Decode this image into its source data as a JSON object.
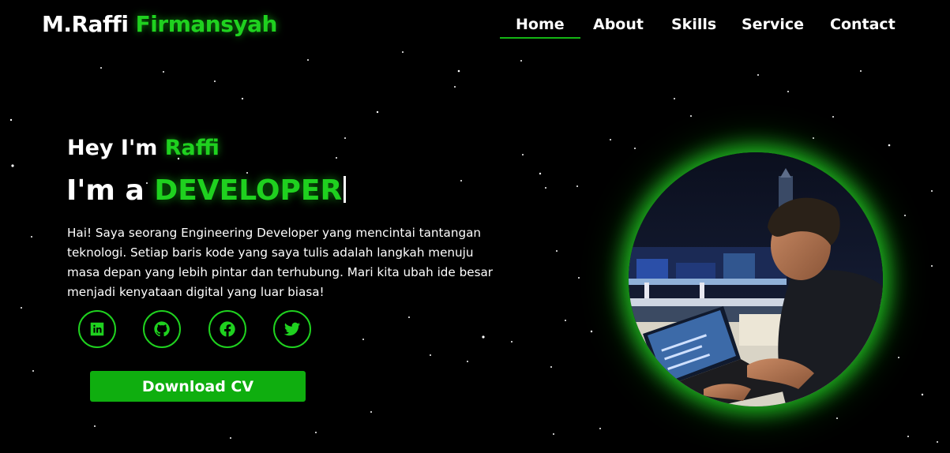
{
  "brand": {
    "first": "M.Raffi",
    "accent": "Firmansyah"
  },
  "nav": {
    "home": "Home",
    "about": "About",
    "skills": "Skills",
    "service": "Service",
    "contact": "Contact",
    "active": "Home"
  },
  "hero": {
    "greeting_prefix": "Hey I'm",
    "greeting_name": "Raffi",
    "role_prefix": "I'm a",
    "role_word": "DEVELOPER",
    "bio": "Hai! Saya seorang Engineering Developer yang mencintai tantangan teknologi. Setiap baris kode yang saya tulis adalah langkah menuju masa depan yang lebih pintar dan terhubung. Mari kita ubah ide besar menjadi kenyataan digital yang luar biasa!",
    "cv_button": "Download CV"
  },
  "socials": [
    {
      "icon": "linkedin-icon"
    },
    {
      "icon": "github-icon"
    },
    {
      "icon": "facebook-icon"
    },
    {
      "icon": "twitter-icon"
    }
  ],
  "colors": {
    "accent": "#1fd11f",
    "button": "#0fae0f",
    "background": "#000000"
  }
}
